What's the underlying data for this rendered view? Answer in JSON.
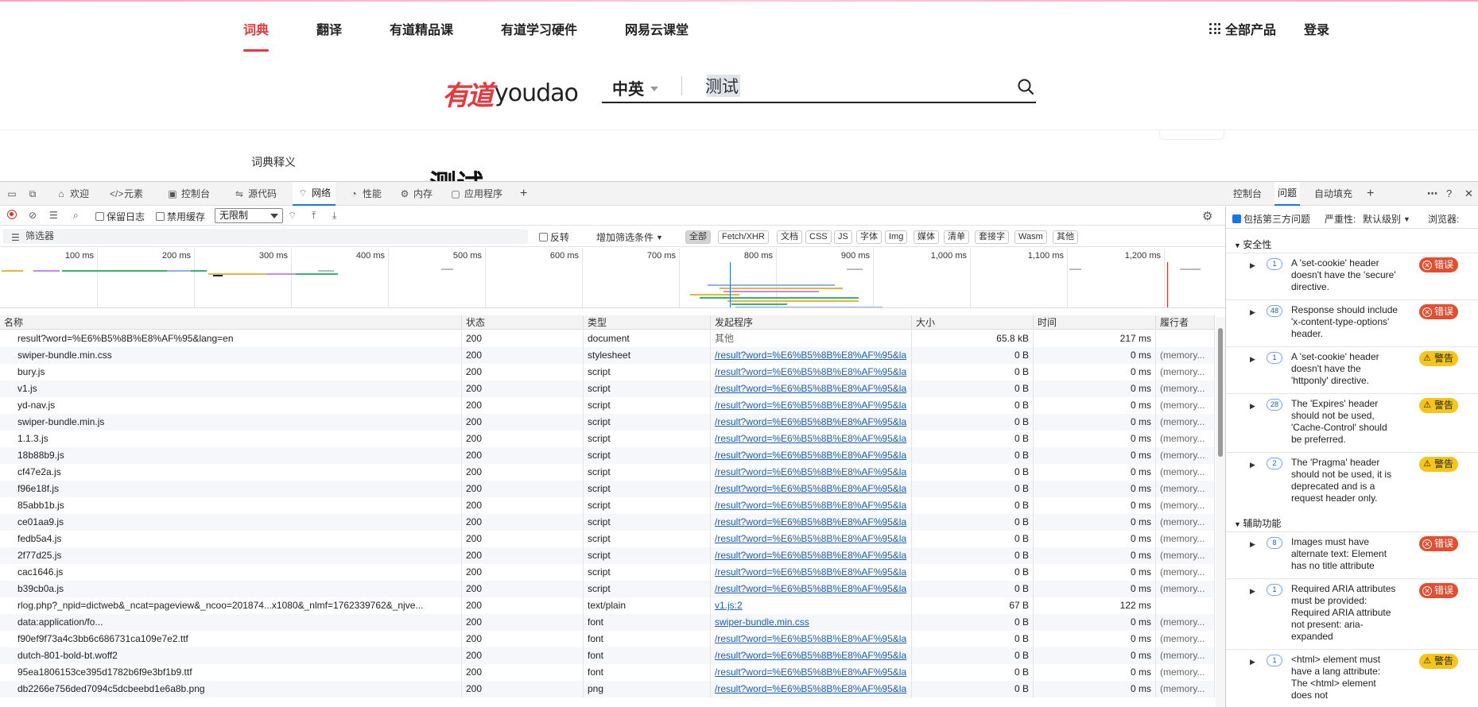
{
  "site": {
    "nav": [
      {
        "label": "词典",
        "active": true
      },
      {
        "label": "翻译",
        "active": false
      },
      {
        "label": "有道精品课",
        "active": false
      },
      {
        "label": "有道学习硬件",
        "active": false
      },
      {
        "label": "网易云课堂",
        "active": false
      }
    ],
    "all_products": "全部产品",
    "login": "登录",
    "logo_cn": "有道",
    "logo_en": "youdao",
    "search": {
      "lang": "中英",
      "value": "测试"
    },
    "dict_label": "词典释义",
    "word": "测试 ..."
  },
  "devtools": {
    "tabs": [
      {
        "label": "欢迎",
        "icon": "home-icon"
      },
      {
        "label": "元素",
        "icon": "code-icon"
      },
      {
        "label": "控制台",
        "icon": "console-icon"
      },
      {
        "label": "源代码",
        "icon": "sources-icon"
      },
      {
        "label": "网络",
        "icon": "wifi-icon",
        "active": true
      },
      {
        "label": "性能",
        "icon": "gauge-icon"
      },
      {
        "label": "内存",
        "icon": "memory-icon"
      },
      {
        "label": "应用程序",
        "icon": "app-icon"
      }
    ],
    "right_tabs": [
      {
        "label": "控制台"
      },
      {
        "label": "问题",
        "active": true
      },
      {
        "label": "自动填充"
      }
    ],
    "toolbar": {
      "preserve_log": "保留日志",
      "disable_cache": "禁用缓存",
      "throttle": "无限制"
    },
    "filter": {
      "placeholder": "筛选器",
      "invert": "反转",
      "more_filters": "增加筛选条件",
      "chips": [
        "全部",
        "Fetch/XHR",
        "文档",
        "CSS",
        "JS",
        "字体",
        "Img",
        "媒体",
        "清单",
        "套接字",
        "Wasm",
        "其他"
      ],
      "active_chip": "全部"
    },
    "timeline_ticks": [
      "100 ms",
      "200 ms",
      "300 ms",
      "400 ms",
      "500 ms",
      "600 ms",
      "700 ms",
      "800 ms",
      "900 ms",
      "1,000 ms",
      "1,100 ms",
      "1,200 ms"
    ],
    "columns": [
      "名称",
      "状态",
      "类型",
      "发起程序",
      "大小",
      "时间",
      "履行者"
    ],
    "rows": [
      {
        "name": "result?word=%E6%B5%8B%E8%AF%95&lang=en",
        "status": "200",
        "type": "document",
        "initiator": "其他",
        "initiator_link": false,
        "size": "65.8 kB",
        "time": "217 ms",
        "fulfilled": ""
      },
      {
        "name": "swiper-bundle.min.css",
        "status": "200",
        "type": "stylesheet",
        "initiator": "/result?word=%E6%B5%8B%E8%AF%95&la",
        "initiator_link": true,
        "size": "0 B",
        "time": "0 ms",
        "fulfilled": "(memory..."
      },
      {
        "name": "bury.js",
        "status": "200",
        "type": "script",
        "initiator": "/result?word=%E6%B5%8B%E8%AF%95&la",
        "initiator_link": true,
        "size": "0 B",
        "time": "0 ms",
        "fulfilled": "(memory..."
      },
      {
        "name": "v1.js",
        "status": "200",
        "type": "script",
        "initiator": "/result?word=%E6%B5%8B%E8%AF%95&la",
        "initiator_link": true,
        "size": "0 B",
        "time": "0 ms",
        "fulfilled": "(memory..."
      },
      {
        "name": "yd-nav.js",
        "status": "200",
        "type": "script",
        "initiator": "/result?word=%E6%B5%8B%E8%AF%95&la",
        "initiator_link": true,
        "size": "0 B",
        "time": "0 ms",
        "fulfilled": "(memory..."
      },
      {
        "name": "swiper-bundle.min.js",
        "status": "200",
        "type": "script",
        "initiator": "/result?word=%E6%B5%8B%E8%AF%95&la",
        "initiator_link": true,
        "size": "0 B",
        "time": "0 ms",
        "fulfilled": "(memory..."
      },
      {
        "name": "1.1.3.js",
        "status": "200",
        "type": "script",
        "initiator": "/result?word=%E6%B5%8B%E8%AF%95&la",
        "initiator_link": true,
        "size": "0 B",
        "time": "0 ms",
        "fulfilled": "(memory..."
      },
      {
        "name": "18b88b9.js",
        "status": "200",
        "type": "script",
        "initiator": "/result?word=%E6%B5%8B%E8%AF%95&la",
        "initiator_link": true,
        "size": "0 B",
        "time": "0 ms",
        "fulfilled": "(memory..."
      },
      {
        "name": "cf47e2a.js",
        "status": "200",
        "type": "script",
        "initiator": "/result?word=%E6%B5%8B%E8%AF%95&la",
        "initiator_link": true,
        "size": "0 B",
        "time": "0 ms",
        "fulfilled": "(memory..."
      },
      {
        "name": "f96e18f.js",
        "status": "200",
        "type": "script",
        "initiator": "/result?word=%E6%B5%8B%E8%AF%95&la",
        "initiator_link": true,
        "size": "0 B",
        "time": "0 ms",
        "fulfilled": "(memory..."
      },
      {
        "name": "85abb1b.js",
        "status": "200",
        "type": "script",
        "initiator": "/result?word=%E6%B5%8B%E8%AF%95&la",
        "initiator_link": true,
        "size": "0 B",
        "time": "0 ms",
        "fulfilled": "(memory..."
      },
      {
        "name": "ce01aa9.js",
        "status": "200",
        "type": "script",
        "initiator": "/result?word=%E6%B5%8B%E8%AF%95&la",
        "initiator_link": true,
        "size": "0 B",
        "time": "0 ms",
        "fulfilled": "(memory..."
      },
      {
        "name": "fedb5a4.js",
        "status": "200",
        "type": "script",
        "initiator": "/result?word=%E6%B5%8B%E8%AF%95&la",
        "initiator_link": true,
        "size": "0 B",
        "time": "0 ms",
        "fulfilled": "(memory..."
      },
      {
        "name": "2f77d25.js",
        "status": "200",
        "type": "script",
        "initiator": "/result?word=%E6%B5%8B%E8%AF%95&la",
        "initiator_link": true,
        "size": "0 B",
        "time": "0 ms",
        "fulfilled": "(memory..."
      },
      {
        "name": "cac1646.js",
        "status": "200",
        "type": "script",
        "initiator": "/result?word=%E6%B5%8B%E8%AF%95&la",
        "initiator_link": true,
        "size": "0 B",
        "time": "0 ms",
        "fulfilled": "(memory..."
      },
      {
        "name": "b39cb0a.js",
        "status": "200",
        "type": "script",
        "initiator": "/result?word=%E6%B5%8B%E8%AF%95&la",
        "initiator_link": true,
        "size": "0 B",
        "time": "0 ms",
        "fulfilled": "(memory..."
      },
      {
        "name": "rlog.php?_npid=dictweb&_ncat=pageview&_ncoo=201874...x1080&_nlmf=1762339762&_njve...",
        "status": "200",
        "type": "text/plain",
        "initiator": "v1.js:2",
        "initiator_link": true,
        "size": "67 B",
        "time": "122 ms",
        "fulfilled": ""
      },
      {
        "name": "data:application/fo...",
        "status": "200",
        "type": "font",
        "initiator": "swiper-bundle.min.css",
        "initiator_link": true,
        "size": "0 B",
        "time": "0 ms",
        "fulfilled": "(memory..."
      },
      {
        "name": "f90ef9f73a4c3bb6c686731ca109e7e2.ttf",
        "status": "200",
        "type": "font",
        "initiator": "/result?word=%E6%B5%8B%E8%AF%95&la",
        "initiator_link": true,
        "size": "0 B",
        "time": "0 ms",
        "fulfilled": "(memory..."
      },
      {
        "name": "dutch-801-bold-bt.woff2",
        "status": "200",
        "type": "font",
        "initiator": "/result?word=%E6%B5%8B%E8%AF%95&la",
        "initiator_link": true,
        "size": "0 B",
        "time": "0 ms",
        "fulfilled": "(memory..."
      },
      {
        "name": "95ea1806153ce395d1782b6f9e3bf1b9.ttf",
        "status": "200",
        "type": "font",
        "initiator": "/result?word=%E6%B5%8B%E8%AF%95&la",
        "initiator_link": true,
        "size": "0 B",
        "time": "0 ms",
        "fulfilled": "(memory..."
      },
      {
        "name": "db2266e756ded7094c5dcbeebd1e6a8b.png",
        "status": "200",
        "type": "png",
        "initiator": "/result?word=%E6%B5%8B%E8%AF%95&la",
        "initiator_link": true,
        "size": "0 B",
        "time": "0 ms",
        "fulfilled": "(memory..."
      }
    ],
    "issues": {
      "third_party": "包括第三方问题",
      "severity_label": "严重性:",
      "severity_value": "默认级别",
      "browser_label": "浏览器:",
      "sections": [
        {
          "title": "安全性",
          "items": [
            {
              "count": "1",
              "text": "A 'set-cookie' header doesn't have the 'secure' directive.",
              "level": "错误",
              "kind": "err"
            },
            {
              "count": "48",
              "text": "Response should include 'x-content-type-options' header.",
              "level": "错误",
              "kind": "err"
            },
            {
              "count": "1",
              "text": "A 'set-cookie' header doesn't have the 'httponly' directive.",
              "level": "警告",
              "kind": "warn"
            },
            {
              "count": "28",
              "text": "The 'Expires' header should not be used, 'Cache-Control' should be preferred.",
              "level": "警告",
              "kind": "warn"
            },
            {
              "count": "2",
              "text": "The 'Pragma' header should not be used, it is deprecated and is a request header only.",
              "level": "警告",
              "kind": "warn"
            }
          ]
        },
        {
          "title": "辅助功能",
          "items": [
            {
              "count": "8",
              "text": "Images must have alternate text: Element has no title attribute",
              "level": "错误",
              "kind": "err"
            },
            {
              "count": "1",
              "text": "Required ARIA attributes must be provided: Required ARIA attribute not present: aria-expanded",
              "level": "错误",
              "kind": "err"
            },
            {
              "count": "1",
              "text": "<html> element must have a lang attribute: The <html> element does not",
              "level": "警告",
              "kind": "warn"
            }
          ]
        }
      ]
    }
  },
  "colors": {
    "brand_red": "#e8383d",
    "link": "#1a5fb4",
    "error": "#e54d2e",
    "warning": "#f5c518",
    "accent": "#1a73e8"
  }
}
